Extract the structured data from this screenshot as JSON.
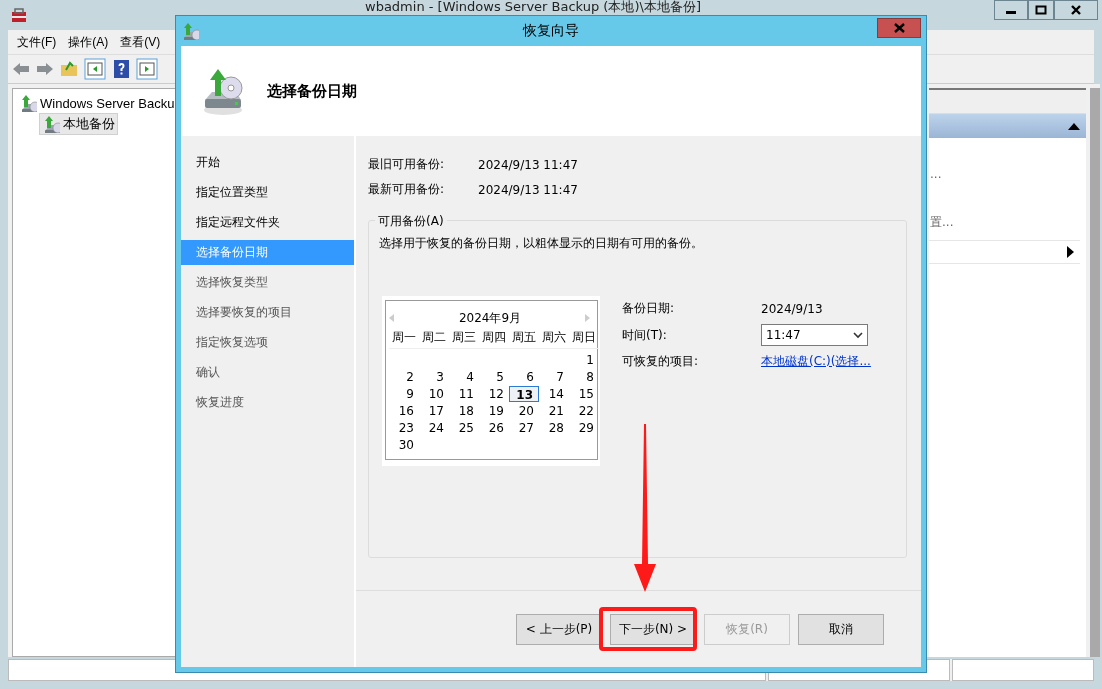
{
  "main_window": {
    "title": "wbadmin - [Windows Server Backup (本地)\\本地备份]",
    "menu": [
      "文件(F)",
      "操作(A)",
      "查看(V)"
    ],
    "tree": [
      {
        "label": "Windows Server Backu",
        "selected": false,
        "children": [
          {
            "label": "本地备份",
            "selected": true
          }
        ]
      }
    ],
    "action_items": [
      "...",
      "置..."
    ]
  },
  "wizard": {
    "title": "恢复向导",
    "heading": "选择备份日期",
    "steps": [
      {
        "label": "开始",
        "selected": false,
        "enabled": true
      },
      {
        "label": "指定位置类型",
        "selected": false,
        "enabled": true
      },
      {
        "label": "指定远程文件夹",
        "selected": false,
        "enabled": true
      },
      {
        "label": "选择备份日期",
        "selected": true,
        "enabled": true
      },
      {
        "label": "选择恢复类型",
        "selected": false,
        "enabled": false
      },
      {
        "label": "选择要恢复的项目",
        "selected": false,
        "enabled": false
      },
      {
        "label": "指定恢复选项",
        "selected": false,
        "enabled": false
      },
      {
        "label": "确认",
        "selected": false,
        "enabled": false
      },
      {
        "label": "恢复进度",
        "selected": false,
        "enabled": false
      }
    ],
    "summary": [
      {
        "label": "最旧可用备份:",
        "value": "2024/9/13 11:47"
      },
      {
        "label": "最新可用备份:",
        "value": "2024/9/13 11:47"
      }
    ],
    "group": {
      "legend": "可用备份(A)",
      "description": "选择用于恢复的备份日期，以粗体显示的日期有可用的备份。"
    },
    "calendar": {
      "month": "2024年9月",
      "weekdays": [
        "周一",
        "周二",
        "周三",
        "周四",
        "周五",
        "周六",
        "周日"
      ],
      "weeks": [
        [
          {
            "day": "1",
            "available": false,
            "selected": false
          }
        ],
        [
          {
            "day": "2",
            "available": false,
            "selected": false
          },
          {
            "day": "3",
            "available": false,
            "selected": false
          },
          {
            "day": "4",
            "available": false,
            "selected": false
          },
          {
            "day": "5",
            "available": false,
            "selected": false
          },
          {
            "day": "6",
            "available": false,
            "selected": false
          },
          {
            "day": "7",
            "available": false,
            "selected": false
          },
          {
            "day": "8",
            "available": false,
            "selected": false
          }
        ],
        [
          {
            "day": "9",
            "available": false,
            "selected": false
          },
          {
            "day": "10",
            "available": false,
            "selected": false
          },
          {
            "day": "11",
            "available": false,
            "selected": false
          },
          {
            "day": "12",
            "available": false,
            "selected": false
          },
          {
            "day": "13",
            "available": true,
            "selected": true
          },
          {
            "day": "14",
            "available": false,
            "selected": false
          },
          {
            "day": "15",
            "available": false,
            "selected": false
          }
        ],
        [
          {
            "day": "16",
            "available": false,
            "selected": false
          },
          {
            "day": "17",
            "available": false,
            "selected": false
          },
          {
            "day": "18",
            "available": false,
            "selected": false
          },
          {
            "day": "19",
            "available": false,
            "selected": false
          },
          {
            "day": "20",
            "available": false,
            "selected": false
          },
          {
            "day": "21",
            "available": false,
            "selected": false
          },
          {
            "day": "22",
            "available": false,
            "selected": false
          }
        ],
        [
          {
            "day": "23",
            "available": false,
            "selected": false
          },
          {
            "day": "24",
            "available": false,
            "selected": false
          },
          {
            "day": "25",
            "available": false,
            "selected": false
          },
          {
            "day": "26",
            "available": false,
            "selected": false
          },
          {
            "day": "27",
            "available": false,
            "selected": false
          },
          {
            "day": "28",
            "available": false,
            "selected": false
          },
          {
            "day": "29",
            "available": false,
            "selected": false
          }
        ],
        [
          {
            "day": "30",
            "available": false,
            "selected": false
          }
        ]
      ]
    },
    "backup_date": {
      "label": "备份日期:",
      "value": "2024/9/13"
    },
    "time": {
      "label": "时间(T):",
      "value": "11:47"
    },
    "items": {
      "label": "可恢复的项目:",
      "link": "本地磁盘(C:)(选择..."
    },
    "buttons": [
      {
        "label": "< 上一步(P)",
        "disabled": false
      },
      {
        "label": "下一步(N) >",
        "disabled": false
      },
      {
        "label": "恢复(R)",
        "disabled": true
      },
      {
        "label": "取消",
        "disabled": false
      }
    ]
  },
  "annotations": {
    "arrow": true,
    "highlight_box": true
  }
}
